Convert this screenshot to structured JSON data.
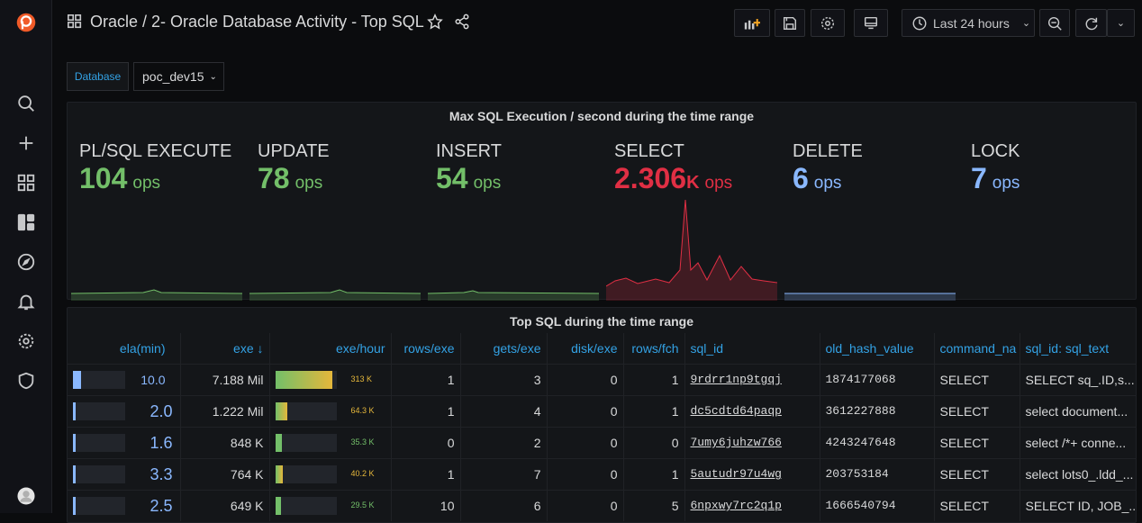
{
  "header": {
    "breadcrumb": "Oracle / 2- Oracle Database Activity - Top SQL",
    "time_range": "Last 24 hours"
  },
  "variables": {
    "database_label": "Database",
    "database_value": "poc_dev15"
  },
  "stats_panel": {
    "title": "Max SQL Execution / second during the time range",
    "stats": [
      {
        "name": "PL/SQL EXECUTE",
        "value": "104",
        "suffix": "",
        "unit": "ops",
        "color": "#73bf69"
      },
      {
        "name": "UPDATE",
        "value": "78",
        "suffix": "",
        "unit": "ops",
        "color": "#73bf69"
      },
      {
        "name": "INSERT",
        "value": "54",
        "suffix": "",
        "unit": "ops",
        "color": "#73bf69"
      },
      {
        "name": "SELECT",
        "value": "2.306",
        "suffix": "K",
        "unit": "ops",
        "color": "#e02f44"
      },
      {
        "name": "DELETE",
        "value": "6",
        "suffix": "",
        "unit": "ops",
        "color": "#8ab8ff"
      },
      {
        "name": "LOCK",
        "value": "7",
        "suffix": "",
        "unit": "ops",
        "color": "#8ab8ff"
      }
    ]
  },
  "table_panel": {
    "title": "Top SQL during the time range",
    "columns": [
      "ela(min)",
      "exe ↓",
      "exe/hour",
      "rows/exe",
      "gets/exe",
      "disk/exe",
      "rows/fch",
      "sql_id",
      "old_hash_value",
      "command_na",
      "sql_id: sql_text"
    ],
    "rows": [
      {
        "ela": "10.0",
        "ela_level": 0.16,
        "exe": "7.188 Mil",
        "exe_hour": "313 K",
        "exe_hour_level": 0.95,
        "exe_hour_color": "#e5b73b",
        "rows_exe": "1",
        "gets_exe": "3",
        "disk_exe": "0",
        "rows_fch": "1",
        "sql_id": "9rdrr1np9tgqj",
        "old_hash": "1874177068",
        "command": "SELECT",
        "sql_text": "SELECT sq_.ID,s..."
      },
      {
        "ela": "2.0",
        "ela_level": 0.03,
        "exe": "1.222 Mil",
        "exe_hour": "64.3 K",
        "exe_hour_level": 0.19,
        "exe_hour_color": "#e5b73b",
        "rows_exe": "1",
        "gets_exe": "4",
        "disk_exe": "0",
        "rows_fch": "1",
        "sql_id": "dc5cdtd64paqp",
        "old_hash": "3612227888",
        "command": "SELECT",
        "sql_text": "select document..."
      },
      {
        "ela": "1.6",
        "ela_level": 0.03,
        "exe": "848 K",
        "exe_hour": "35.3 K",
        "exe_hour_level": 0.1,
        "exe_hour_color": "#73bf69",
        "rows_exe": "0",
        "gets_exe": "2",
        "disk_exe": "0",
        "rows_fch": "0",
        "sql_id": "7umy6juhzw766",
        "old_hash": "4243247648",
        "command": "SELECT",
        "sql_text": "select /*+ conne..."
      },
      {
        "ela": "3.3",
        "ela_level": 0.05,
        "exe": "764 K",
        "exe_hour": "40.2 K",
        "exe_hour_level": 0.12,
        "exe_hour_color": "#e5b73b",
        "rows_exe": "1",
        "gets_exe": "7",
        "disk_exe": "0",
        "rows_fch": "1",
        "sql_id": "5autudr97u4wg",
        "old_hash": "203753184",
        "command": "SELECT",
        "sql_text": "select lots0_.ldd_..."
      },
      {
        "ela": "2.5",
        "ela_level": 0.04,
        "exe": "649 K",
        "exe_hour": "29.5 K",
        "exe_hour_level": 0.09,
        "exe_hour_color": "#73bf69",
        "rows_exe": "10",
        "gets_exe": "6",
        "disk_exe": "0",
        "rows_fch": "5",
        "sql_id": "6npxwy7rc2q1p",
        "old_hash": "1666540794",
        "command": "SELECT",
        "sql_text": "SELECT ID, JOB_..."
      }
    ]
  }
}
